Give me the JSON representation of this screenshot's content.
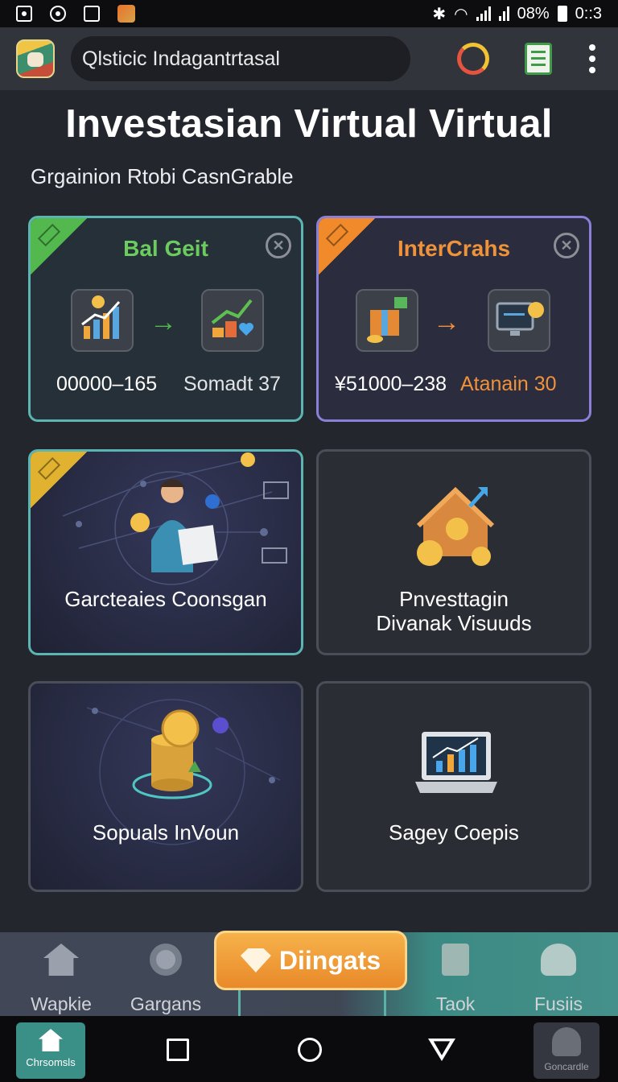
{
  "status_bar": {
    "battery": "08%",
    "time": "0::3"
  },
  "header": {
    "search_value": "Qlsticic Indagantrtasal"
  },
  "page": {
    "title": "Investasian Virtual Virtual",
    "subtitle": "Grgainion Rtobi CasnGrable"
  },
  "cards": [
    {
      "title": "Bal Geit",
      "left_value": "00000–165",
      "right_value": "Somadt 37",
      "accent": "#5cb85c"
    },
    {
      "title": "InterCrahs",
      "left_value": "¥51000–238",
      "right_value": "Atanain 30",
      "accent": "#f0923a"
    },
    {
      "label": "Garcteaies Coonsgan"
    },
    {
      "label_line1": "Pnvesttagin",
      "label_line2": "Divanak Visuuds"
    },
    {
      "label": "Sopuals InVoun"
    },
    {
      "label": "Sagey Coepis"
    }
  ],
  "bottom_nav": {
    "items": [
      {
        "label": "Wapkie",
        "icon": "home-icon"
      },
      {
        "label": "Gargans",
        "icon": "gear-icon"
      },
      {
        "label": "Taok",
        "icon": "document-icon"
      },
      {
        "label": "Fusiis",
        "icon": "person-icon"
      }
    ],
    "center_label": "Diingats"
  },
  "system_nav": {
    "home_label": "Chrsomsls",
    "profile_label": "Goncardle"
  },
  "colors": {
    "background": "#24262d",
    "teal": "#5cb5b2",
    "purple": "#8b7fd7",
    "orange": "#f0923a",
    "green": "#5cb85c"
  }
}
